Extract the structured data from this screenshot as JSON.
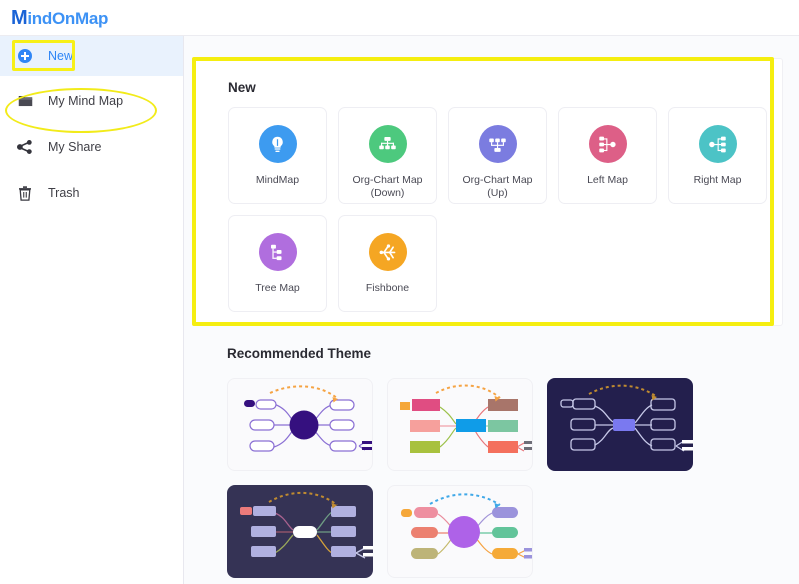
{
  "app": {
    "logo_first": "M",
    "logo_rest": "indOnMap"
  },
  "sidebar": {
    "items": [
      {
        "label": "New",
        "icon": "plus-circle-icon",
        "active": true
      },
      {
        "label": "My Mind Map",
        "icon": "folder-icon",
        "active": false
      },
      {
        "label": "My Share",
        "icon": "share-icon",
        "active": false
      },
      {
        "label": "Trash",
        "icon": "trash-icon",
        "active": false
      }
    ]
  },
  "main": {
    "new_section": {
      "title": "New",
      "cards": [
        {
          "label": "MindMap",
          "icon": "lightbulb-icon",
          "color": "#3d9bf0"
        },
        {
          "label": "Org-Chart Map (Down)",
          "icon": "org-chart-down-icon",
          "color": "#4dc97e"
        },
        {
          "label": "Org-Chart Map (Up)",
          "icon": "org-chart-up-icon",
          "color": "#7b7ce0"
        },
        {
          "label": "Left Map",
          "icon": "left-map-icon",
          "color": "#dd5f87"
        },
        {
          "label": "Right Map",
          "icon": "right-map-icon",
          "color": "#4cc3c6"
        },
        {
          "label": "Tree Map",
          "icon": "tree-map-icon",
          "color": "#b濾"
        },
        {
          "label": "Fishbone",
          "icon": "fishbone-icon",
          "color": "#f5a623"
        }
      ],
      "card_colors": {
        "mindmap": "#3d9bf0",
        "org_down": "#4dc97e",
        "org_up": "#7b7ce0",
        "left_map": "#dd5f87",
        "right_map": "#4cc3c6",
        "tree_map": "#b濾",
        "tree_map_hex": "#b06ede",
        "fishbone": "#f5a623"
      }
    },
    "theme_section": {
      "title": "Recommended Theme",
      "themes": [
        {
          "name": "classic-purple",
          "background": "#fafafc",
          "center": "#35107f",
          "accent": "#8a6fd4",
          "arrow": "#f5a343",
          "dark": false
        },
        {
          "name": "colorful-blocks",
          "background": "#fafafc",
          "center": "#1b9ff0",
          "accent": "#e8637e",
          "arrow": "#f5a343",
          "dark": false
        },
        {
          "name": "midnight-blue",
          "background": "#231f4d",
          "center": "#7a79f0",
          "accent": "#c6c8e8",
          "arrow": "#c08b30",
          "dark": true
        },
        {
          "name": "midnight-white",
          "background": "#353355",
          "center": "#ffffff",
          "accent": "#b5b6e0",
          "arrow": "#c08b30",
          "dark": true
        },
        {
          "name": "lavender-bloom",
          "background": "#fafafc",
          "center": "#ae62e8",
          "accent": "#e98c9c",
          "arrow": "#3fa8e8",
          "dark": false
        }
      ]
    }
  },
  "annotations": {
    "highlight_color": "#f5ee10",
    "new_button_box": "rectangle",
    "my_mind_map_oval": "ellipse",
    "new_panel_box": "rectangle"
  }
}
